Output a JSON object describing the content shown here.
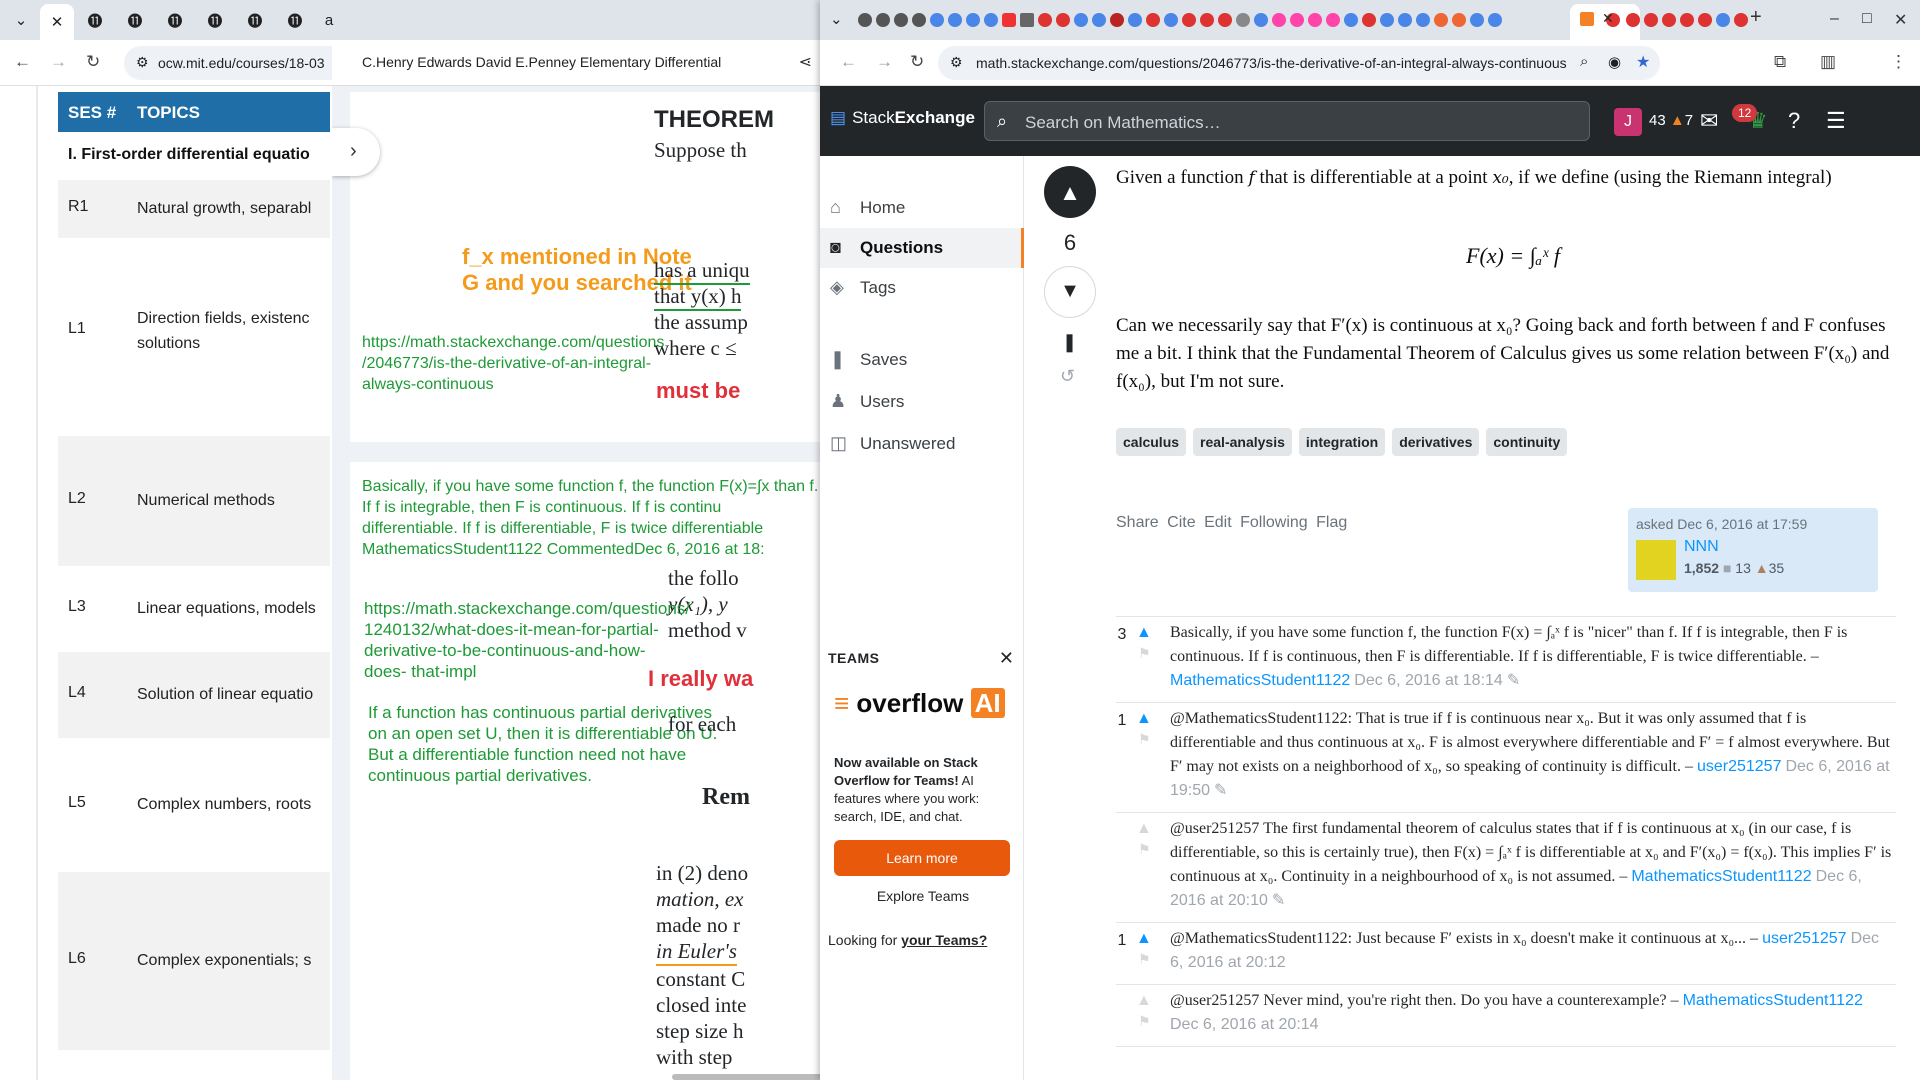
{
  "left_browser": {
    "url": "ocw.mit.edu/courses/18-03",
    "tabs_active_close": "✕"
  },
  "mit": {
    "col_ses": "SES #",
    "col_topics": "TOPICS",
    "section": "I. First-order differential equatio",
    "rows": [
      {
        "ses": "R1",
        "topic": "Natural growth, separabl"
      },
      {
        "ses": "L1",
        "topic": "Direction fields, existenc solutions"
      },
      {
        "ses": "L2",
        "topic": "Numerical methods"
      },
      {
        "ses": "L3",
        "topic": "Linear equations, models"
      },
      {
        "ses": "L4",
        "topic": "Solution of linear equatio"
      },
      {
        "ses": "L5",
        "topic": "Complex numbers, roots"
      },
      {
        "ses": "L6",
        "topic": "Complex exponentials; s"
      }
    ]
  },
  "pdf": {
    "title": "C.Henry Edwards David E.Penney Elementary Differential",
    "page1": {
      "heading": "THEOREM",
      "line1": "Suppose th",
      "orange_note": "f_x mentioned in Note G and you searched it",
      "link1": "https://math.stackexchange.com/questions /2046773/is-the-derivative-of-an-integral- always-continuous",
      "text_a": "has a uniqu",
      "text_b": "that y(x) h",
      "text_c": "the assump",
      "text_d": "where c ≤",
      "red1": "must be"
    },
    "page2": {
      "green_comment": "Basically, if you have some function f, the function F(x)=∫x than f. If f is integrable, then F is continuous. If f is continu differentiable. If f is differentiable, F is twice differentiable MathematicsStudent1122 CommentedDec 6, 2016 at 18:",
      "text_follow": "the follo",
      "text_y": "y(x₁), y",
      "text_method": "method v",
      "link2": "https://math.stackexchange.com/questions/ 1240132/what-does-it-mean-for-partial- derivative-to-be-continuous-and-how-does- that-impl",
      "red2": "I really wa",
      "green_note2": "If a function has continuous partial derivatives on an open set U, then it is differentiable on U. But a differentiable function need not have continuous partial derivatives.",
      "text_each": "for each",
      "rem": "Rem",
      "para": [
        "in (2) deno",
        "mation, ex",
        "made no r",
        "in Euler's",
        "constant C",
        "closed inte",
        "step size h",
        "with step"
      ]
    }
  },
  "right_browser": {
    "url": "math.stackexchange.com/questions/2046773/is-the-derivative-of-an-integral-always-continuous",
    "tab_close": "✕",
    "new_tab": "+"
  },
  "se": {
    "logo_a": "Stack",
    "logo_b": "Exchange",
    "search_placeholder": "Search on Mathematics…",
    "avatar_letter": "J",
    "rep": "43",
    "bronze": "7",
    "inbox_count": "12",
    "nav": [
      "Home",
      "Questions",
      "Tags",
      "Saves",
      "Users",
      "Unanswered"
    ],
    "teams_heading": "TEAMS",
    "oai_word": "overflow",
    "oai_ai": "AI",
    "oai_text_bold": "Now available on Stack Overflow for Teams!",
    "oai_text": " AI features where you work: search, IDE, and chat.",
    "learn_more": "Learn more",
    "explore_teams": "Explore Teams",
    "looking_for": "Looking for ",
    "your_teams": "your Teams?"
  },
  "question": {
    "score": "6",
    "p1a": "Given a function ",
    "p1b": " that is differentiable at a point ",
    "p1c": ", if we define (using the Riemann integral)",
    "formula": "F(x) = ∫ₐˣ f",
    "p2": "Can we necessarily say that F′(x) is continuous at x₀? Going back and forth between f and F confuses me a bit. I think that the Fundamental Theorem of Calculus gives us some relation between F′(x₀) and f(x₀), but I'm not sure.",
    "tags": [
      "calculus",
      "real-analysis",
      "integration",
      "derivatives",
      "continuity"
    ],
    "actions": [
      "Share",
      "Cite",
      "Edit",
      "Following",
      "Flag"
    ],
    "asked": "asked Dec 6, 2016 at 17:59",
    "user": "NNN",
    "user_rep": "1,852",
    "silver": "13",
    "bronze": "35"
  },
  "comments": [
    {
      "score": "3",
      "text": "Basically, if you have some function f, the function F(x) = ∫ₐˣ f is \"nicer\" than f. If f is integrable, then F is continuous. If f is continuous, then F is differentiable. If f is differentiable, F is twice differentiable. –",
      "user": "MathematicsStudent1122",
      "date": "Dec 6, 2016 at 18:14"
    },
    {
      "score": "1",
      "text": "@MathematicsStudent1122: That is true if f is continuous near x₀. But it was only assumed that f is differentiable and thus continuous at x₀. F is almost everywhere differentiable and F′ = f almost everywhere. But F′ may not exists on a neighborhood of x₀, so speaking of continuity is difficult. –",
      "user": "user251257",
      "date": "Dec 6, 2016 at 19:50"
    },
    {
      "score": "",
      "text": "@user251257 The first fundamental theorem of calculus states that if f is continuous at x₀ (in our case, f is differentiable, so this is certainly true), then F(x) = ∫ₐˣ f is differentiable at x₀ and F′(x₀) = f(x₀). This implies F′ is continuous at x₀. Continuity in a neighbourhood of x₀ is not assumed. –",
      "user": "MathematicsStudent1122",
      "date": "Dec 6, 2016 at 20:10"
    },
    {
      "score": "1",
      "text": "@MathematicsStudent1122: Just because F′ exists in x₀ doesn't make it continuous at x₀... –",
      "user": "user251257",
      "date": "Dec 6, 2016 at 20:12"
    },
    {
      "score": "",
      "text": "@user251257 Never mind, you're right then. Do you have a counterexample? –",
      "user": "MathematicsStudent1122",
      "date": "Dec 6, 2016 at 20:14"
    }
  ]
}
